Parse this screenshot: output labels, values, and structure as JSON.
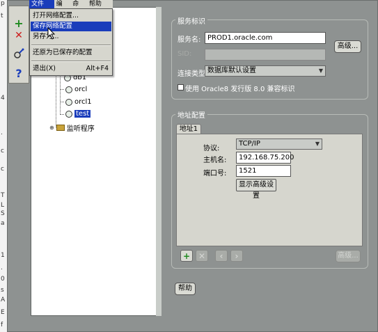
{
  "left_strip": [
    "p",
    "t",
    "4",
    ".",
    "c",
    "c",
    "T",
    "L",
    "S",
    "a",
    "1",
    ".",
    "0",
    "s",
    "A",
    "E",
    "f"
  ],
  "menubar": [
    "文件(F)",
    "编辑",
    "命令",
    "帮助(H)"
  ],
  "file_menu": {
    "items": [
      {
        "label": "打开网络配置...",
        "shortcut": ""
      },
      {
        "label": "保存网络配置",
        "shortcut": ""
      },
      {
        "label": "另存为...",
        "shortcut": ""
      },
      {
        "label": "还原为已保存的配置",
        "shortcut": ""
      },
      {
        "label": "退出(X)",
        "shortcut": "Alt+F4"
      }
    ]
  },
  "toolbar": {
    "add": "+",
    "remove": "✕",
    "help": "?"
  },
  "tree": {
    "items": [
      "db1",
      "orcl",
      "orcl1",
      "test",
      "监听程序"
    ]
  },
  "service_id": {
    "title": "服务标识",
    "service_name_label": "服务名:",
    "service_name_value": "PROD1.oracle.com",
    "sid_label": "SID:",
    "sid_value": "",
    "advanced_button": "高级...",
    "conn_type_label": "连接类型:",
    "conn_type_value": "数据库默认设置",
    "compat_label": "使用 Oracle8 发行版 8.0 兼容标识"
  },
  "address_config": {
    "title": "地址配置",
    "tab": "地址1",
    "protocol_label": "协议:",
    "protocol_value": "TCP/IP",
    "host_label": "主机名:",
    "host_value": "192.168.75.200",
    "port_label": "端口号:",
    "port_value": "1521",
    "show_advanced_button": "显示高级设置",
    "advanced_button": "高级..."
  },
  "help_button": "帮助",
  "colors": {
    "background": "#8e9291",
    "selection": "#1a3dbb",
    "add": "#1f8a1f",
    "remove": "#cc1a1a"
  }
}
